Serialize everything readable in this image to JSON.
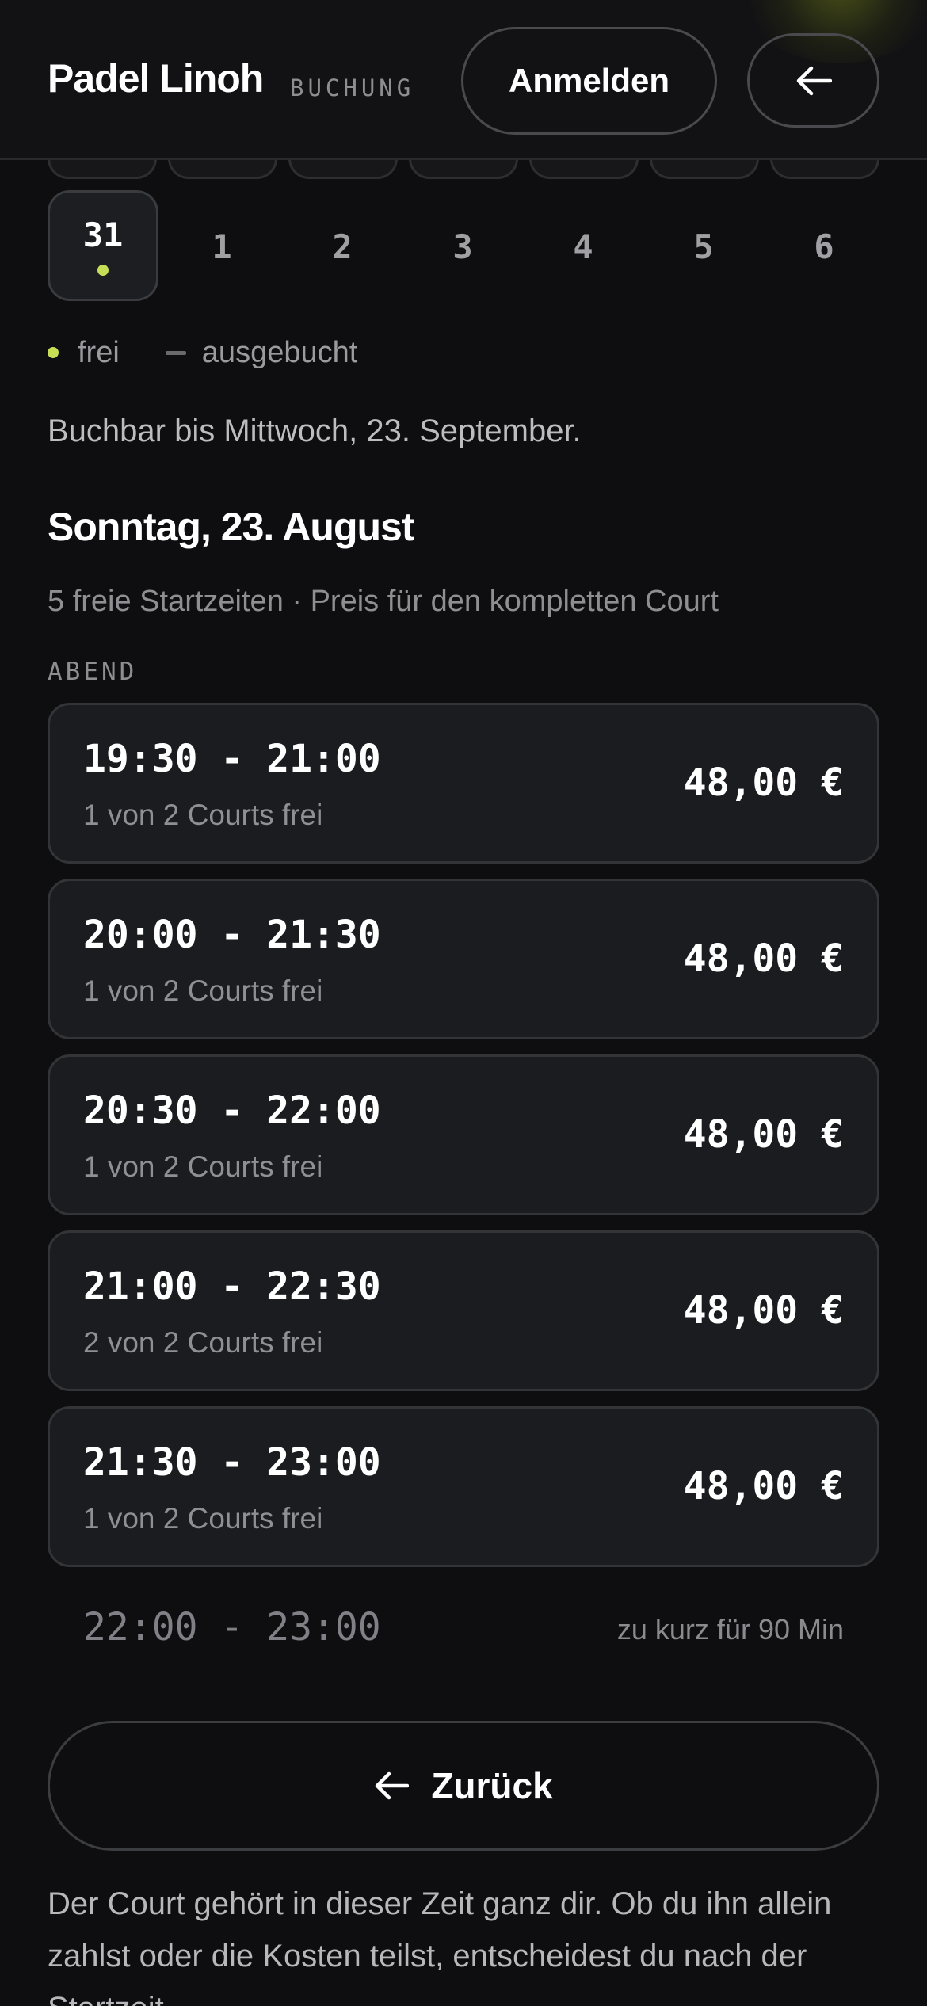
{
  "header": {
    "brand": "Padel Linoh",
    "brand_sub": "BUCHUNG",
    "login_label": "Anmelden",
    "back_icon": "arrow-left-icon"
  },
  "calendar": {
    "days": [
      {
        "label": "31",
        "active": true,
        "free": true
      },
      {
        "label": "1",
        "active": false,
        "free": false
      },
      {
        "label": "2",
        "active": false,
        "free": false
      },
      {
        "label": "3",
        "active": false,
        "free": false
      },
      {
        "label": "4",
        "active": false,
        "free": false
      },
      {
        "label": "5",
        "active": false,
        "free": false
      },
      {
        "label": "6",
        "active": false,
        "free": false
      }
    ]
  },
  "legend": {
    "free": "frei",
    "booked": "ausgebucht"
  },
  "bookable_until": "Buchbar bis Mittwoch, 23. September.",
  "selected_date": {
    "title": "Sonntag, 23. August",
    "subtitle": "5 freie Startzeiten · Preis für den kompletten Court"
  },
  "section_label": "ABEND",
  "slots": [
    {
      "time": "19:30 - 21:00",
      "availability": "1 von 2 Courts frei",
      "price": "48,00 €"
    },
    {
      "time": "20:00 - 21:30",
      "availability": "1 von 2 Courts frei",
      "price": "48,00 €"
    },
    {
      "time": "20:30 - 22:00",
      "availability": "1 von 2 Courts frei",
      "price": "48,00 €"
    },
    {
      "time": "21:00 - 22:30",
      "availability": "2 von 2 Courts frei",
      "price": "48,00 €"
    },
    {
      "time": "21:30 - 23:00",
      "availability": "1 von 2 Courts frei",
      "price": "48,00 €"
    }
  ],
  "disabled_slot": {
    "time": "22:00 - 23:00",
    "note": "zu kurz für 90 Min"
  },
  "back_button": {
    "label": "Zurück",
    "icon": "arrow-left-icon"
  },
  "footnote": "Der Court gehört in dieser Zeit ganz dir. Ob du ihn allein zahlst oder die Kosten teilst, entscheidest du nach der Startzeit.",
  "colors": {
    "background": "#0e0e10",
    "accent": "#c7dd55",
    "card": "#1b1c1f"
  }
}
